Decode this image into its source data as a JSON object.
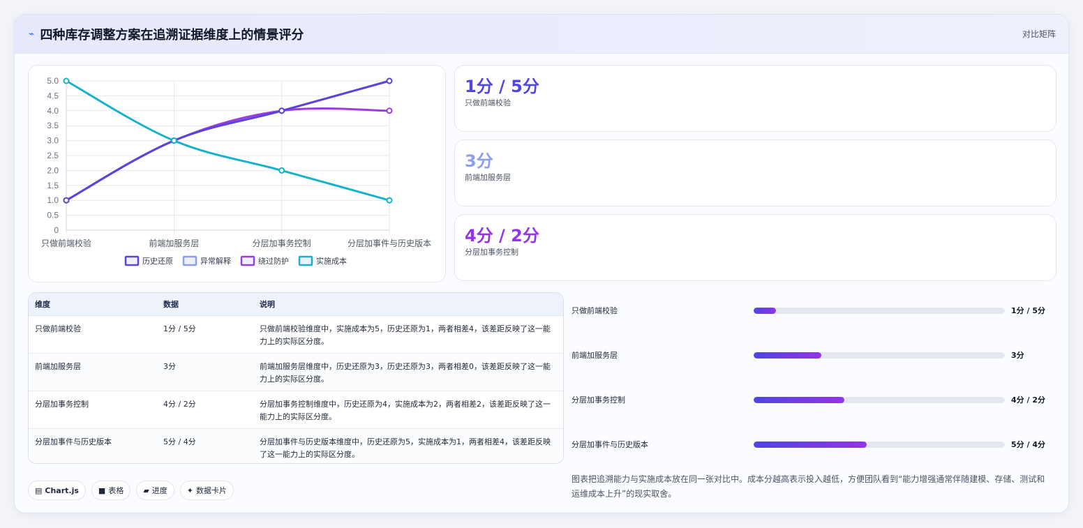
{
  "header": {
    "icon": "pulse-icon",
    "title": "四种库存调整方案在追溯证据维度上的情景评分",
    "tag": "对比矩阵"
  },
  "chart_data": {
    "type": "line",
    "categories": [
      "只做前端校验",
      "前端加服务层",
      "分层加事务控制",
      "分层加事件与历史版本"
    ],
    "series": [
      {
        "name": "历史还原",
        "values": [
          1,
          3,
          4,
          5
        ],
        "color": "#5b45d8"
      },
      {
        "name": "异常解释",
        "values": [
          1,
          3,
          4,
          5
        ],
        "color": "#8b9ef0"
      },
      {
        "name": "绕过防护",
        "values": [
          1,
          3,
          4,
          4
        ],
        "color": "#9b3de0"
      },
      {
        "name": "实施成本",
        "values": [
          5,
          3,
          2,
          1
        ],
        "color": "#14b3c9"
      }
    ],
    "ylim": [
      0,
      5
    ],
    "yticks": [
      "0",
      "0.5",
      "1.0",
      "1.5",
      "2.0",
      "2.5",
      "3.0",
      "3.5",
      "4.0",
      "4.5",
      "5.0"
    ],
    "grid": true,
    "legend": "bottom"
  },
  "kpis": [
    {
      "value": "1分 / 5分",
      "label": "只做前端校验",
      "color": "#4f46e5"
    },
    {
      "value": "3分",
      "label": "前端加服务层",
      "color": "#8b9ef0"
    },
    {
      "value": "4分 / 2分",
      "label": "分层加事务控制",
      "color": "#9333ea"
    }
  ],
  "table": {
    "headers": [
      "维度",
      "数据",
      "说明"
    ],
    "rows": [
      [
        "只做前端校验",
        "1分 / 5分",
        "只做前端校验维度中，实施成本为5，历史还原为1，两者相差4，该差距反映了这一能力上的实际区分度。"
      ],
      [
        "前端加服务层",
        "3分",
        "前端加服务层维度中，历史还原为3，历史还原为3，两者相差0，该差距反映了这一能力上的实际区分度。"
      ],
      [
        "分层加事务控制",
        "4分 / 2分",
        "分层加事务控制维度中，历史还原为4，实施成本为2，两者相差2，该差距反映了这一能力上的实际区分度。"
      ],
      [
        "分层加事件与历史版本",
        "5分 / 4分",
        "分层加事件与历史版本维度中，历史还原为5，实施成本为1，两者相差4，该差距反映了这一能力上的实际区分度。"
      ]
    ]
  },
  "chips": [
    {
      "icon": "chart-icon",
      "glyph": "▤",
      "label": "Chart.js"
    },
    {
      "icon": "table-icon",
      "glyph": "■",
      "label": "表格"
    },
    {
      "icon": "progress-icon",
      "glyph": "▰",
      "label": "进度"
    },
    {
      "icon": "sparkle-icon",
      "glyph": "✦",
      "label": "数据卡片"
    }
  ],
  "progress": [
    {
      "label": "只做前端校验",
      "value": "1分 / 5分",
      "fraction": 0.09
    },
    {
      "label": "前端加服务层",
      "value": "3分",
      "fraction": 0.27
    },
    {
      "label": "分层加事务控制",
      "value": "4分 / 2分",
      "fraction": 0.36
    },
    {
      "label": "分层加事件与历史版本",
      "value": "5分 / 4分",
      "fraction": 0.45
    }
  ],
  "note": "图表把追溯能力与实施成本放在同一张对比中。成本分越高表示投入越低，方便团队看到“能力增强通常伴随建模、存储、测试和运维成本上升”的现实取舍。"
}
